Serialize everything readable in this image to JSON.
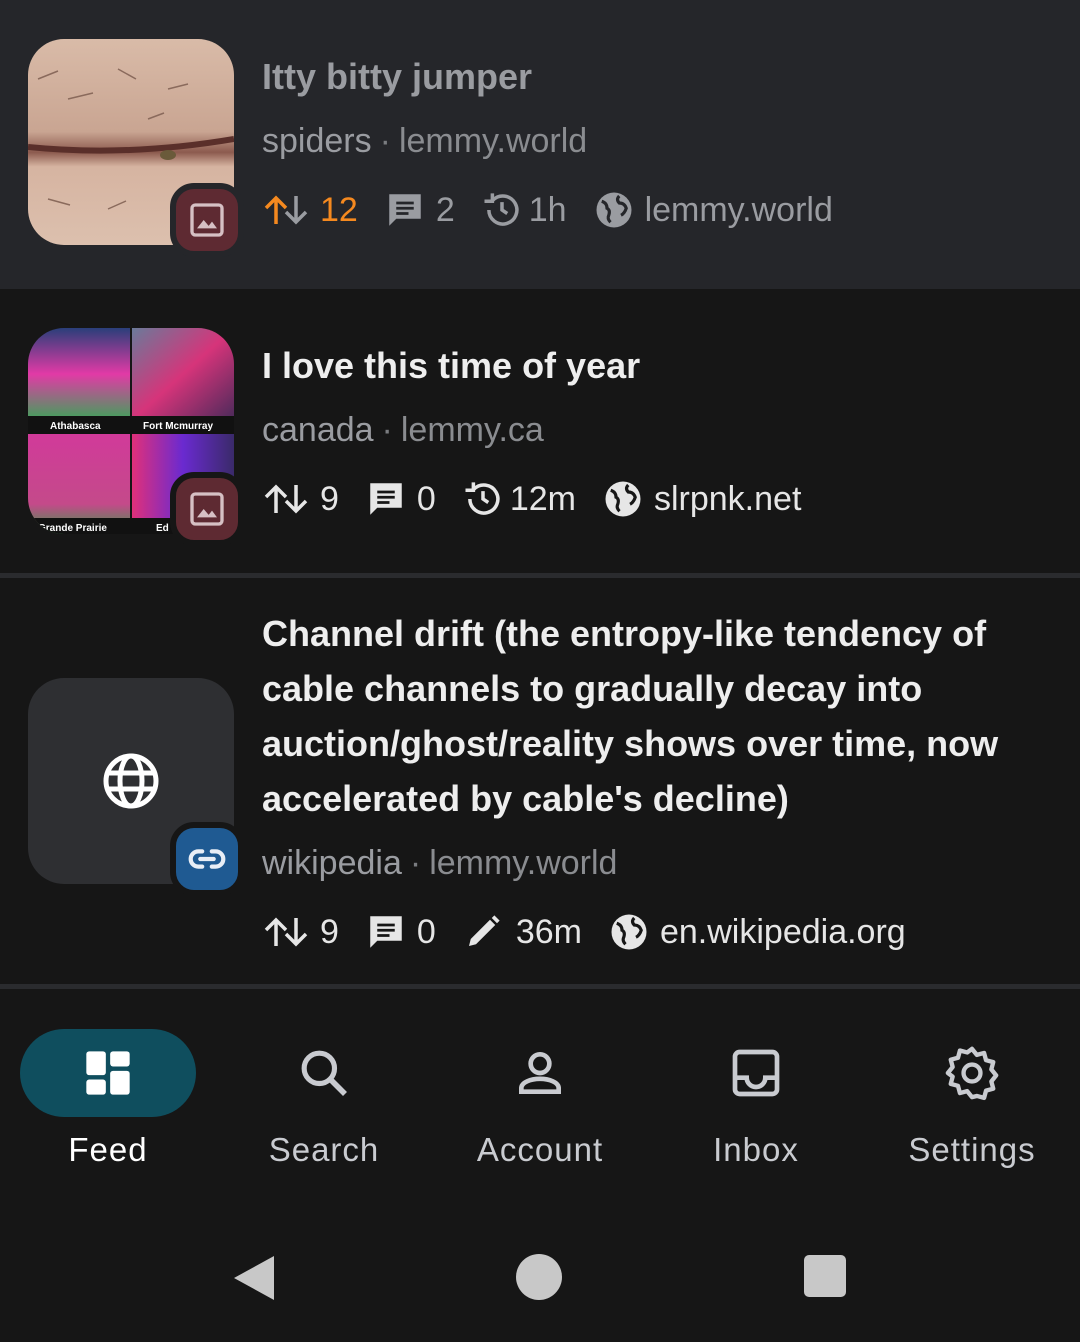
{
  "posts": [
    {
      "title": "Itty bitty jumper",
      "community": "spiders",
      "instance": "lemmy.world",
      "score": "12",
      "comments": "2",
      "age": "1h",
      "domain": "lemmy.world",
      "badge": "image-icon",
      "score_color": "#f5891f"
    },
    {
      "title": "I love this time of year",
      "community": "canada",
      "instance": "lemmy.ca",
      "score": "9",
      "comments": "0",
      "age": "12m",
      "domain": "slrpnk.net",
      "badge": "image-icon",
      "thumb_labels": [
        "Athabasca",
        "Fort Mcmurray",
        "Grande Prairie",
        "Ed"
      ]
    },
    {
      "title": "Channel drift (the entropy-like tendency of cable channels to gradually decay into auction/ghost/reality shows over time, now accelerated by cable's decline)",
      "community": "wikipedia",
      "instance": "lemmy.world",
      "score": "9",
      "comments": "0",
      "age": "36m",
      "domain": "en.wikipedia.org",
      "badge": "link-icon"
    }
  ],
  "nav": [
    {
      "label": "Feed",
      "icon": "feed-icon",
      "active": true
    },
    {
      "label": "Search",
      "icon": "search-icon"
    },
    {
      "label": "Account",
      "icon": "account-icon"
    },
    {
      "label": "Inbox",
      "icon": "inbox-icon"
    },
    {
      "label": "Settings",
      "icon": "settings-icon"
    }
  ],
  "colors": {
    "accent": "#0f4e5e",
    "upvoted": "#f5891f",
    "image_badge": "#5e2a32",
    "link_badge": "#1f5a92"
  }
}
